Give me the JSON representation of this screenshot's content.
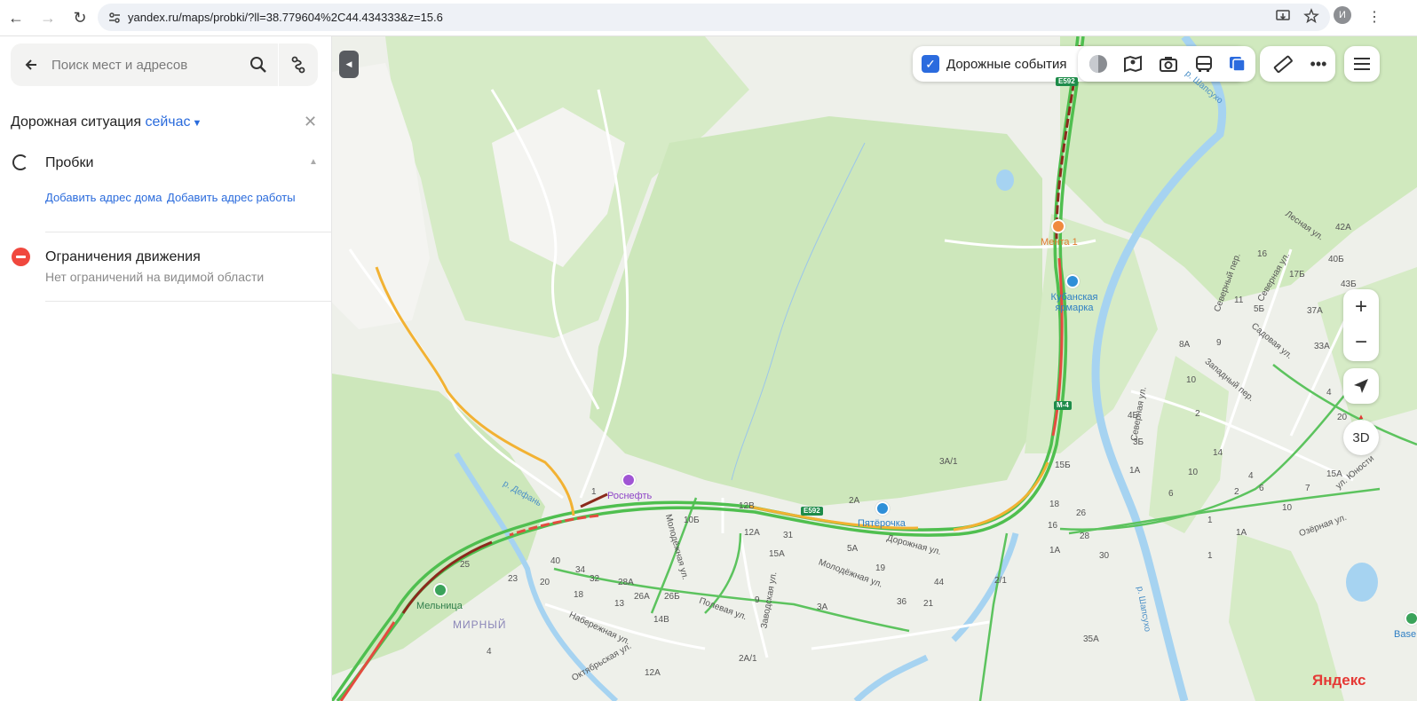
{
  "browser": {
    "url": "yandex.ru/maps/probki/?ll=38.779604%2C44.434333&z=15.6",
    "profile_initial": "И"
  },
  "panel": {
    "search_placeholder": "Поиск мест и адресов",
    "situation_label": "Дорожная ситуация",
    "situation_time": "сейчас",
    "traffic_title": "Пробки",
    "add_home": "Добавить адрес дома",
    "add_work": "Добавить адрес работы",
    "restrictions_title": "Ограничения движения",
    "restrictions_sub": "Нет ограничений на видимой области"
  },
  "map": {
    "road_events_label": "Дорожные события",
    "road_events_checked": true,
    "layers": [
      "traffic-layer-icon",
      "panorama-icon",
      "camera-icon",
      "transit-icon",
      "layers-icon",
      "ruler-icon",
      "more-icon"
    ],
    "zoom_in": "+",
    "zoom_out": "−",
    "view_3d": "3D",
    "brand": "Яндекс",
    "pois": {
      "menta": "Мента 1",
      "kuban": "Кубанская ярмарка",
      "rosneft": "Роснефть",
      "pyaterochka": "Пятёрочка",
      "melnitsa": "Мельница",
      "base": "Base"
    },
    "road_shields": {
      "e592_top": "E592",
      "m4": "M-4",
      "e592_mid": "E592"
    },
    "places": {
      "mirny": "МИРНЫЙ",
      "river_defan": "р. Дефань",
      "river_shapsugo": "р. Шапсухо",
      "river_top": "р. Шапсухо"
    },
    "streets": {
      "lesnaya": "Лесная ул.",
      "severny": "Северный пер.",
      "severnaya_top": "Северная ул.",
      "sadovaya": "Садовая ул.",
      "zapadny": "Западный пер.",
      "severnaya": "Северная ул.",
      "yunosti": "ул. Юности",
      "ozernaya": "Озёрная ул.",
      "dorozhnaya": "Дорожная ул.",
      "molodezhnaya1": "Молодёжная ул.",
      "molodezhnaya2": "Молодёжная ул.",
      "polevaya": "Полевая ул.",
      "zavodskaya": "Заводская ул.",
      "naberezhnaya": "Набережная ул.",
      "oktyabrskaya": "Октябрьская ул."
    },
    "house_numbers": [
      {
        "t": "42А"
      },
      {
        "t": "16"
      },
      {
        "t": "40Б"
      },
      {
        "t": "17Б"
      },
      {
        "t": "43Б"
      },
      {
        "t": "37А"
      },
      {
        "t": "5Б"
      },
      {
        "t": "11"
      },
      {
        "t": "33А"
      },
      {
        "t": "8А"
      },
      {
        "t": "9"
      },
      {
        "t": "10"
      },
      {
        "t": "4"
      },
      {
        "t": "20"
      },
      {
        "t": "15А"
      },
      {
        "t": "15Б"
      },
      {
        "t": "3А/1"
      },
      {
        "t": "2А"
      },
      {
        "t": "18"
      },
      {
        "t": "26"
      },
      {
        "t": "16"
      },
      {
        "t": "28"
      },
      {
        "t": "1А"
      },
      {
        "t": "30"
      },
      {
        "t": "10Б"
      },
      {
        "t": "12В"
      },
      {
        "t": "12А"
      },
      {
        "t": "31"
      },
      {
        "t": "15А"
      },
      {
        "t": "5А"
      },
      {
        "t": "19"
      },
      {
        "t": "44"
      },
      {
        "t": "36"
      },
      {
        "t": "21"
      },
      {
        "t": "2/1"
      },
      {
        "t": "35А"
      },
      {
        "t": "25"
      },
      {
        "t": "23"
      },
      {
        "t": "40"
      },
      {
        "t": "34"
      },
      {
        "t": "32"
      },
      {
        "t": "28А"
      },
      {
        "t": "26А"
      },
      {
        "t": "26Б"
      },
      {
        "t": "14В"
      },
      {
        "t": "20"
      },
      {
        "t": "18"
      },
      {
        "t": "13"
      },
      {
        "t": "9"
      },
      {
        "t": "3А"
      },
      {
        "t": "2А/1"
      },
      {
        "t": "4"
      },
      {
        "t": "12А"
      },
      {
        "t": "1"
      },
      {
        "t": "1"
      },
      {
        "t": "3Б"
      },
      {
        "t": "4Б"
      },
      {
        "t": "1А"
      },
      {
        "t": "2"
      },
      {
        "t": "6"
      },
      {
        "t": "14"
      },
      {
        "t": "10"
      },
      {
        "t": "4"
      },
      {
        "t": "6"
      },
      {
        "t": "10"
      },
      {
        "t": "7"
      },
      {
        "t": "1А"
      },
      {
        "t": "1"
      },
      {
        "t": "2"
      }
    ]
  }
}
